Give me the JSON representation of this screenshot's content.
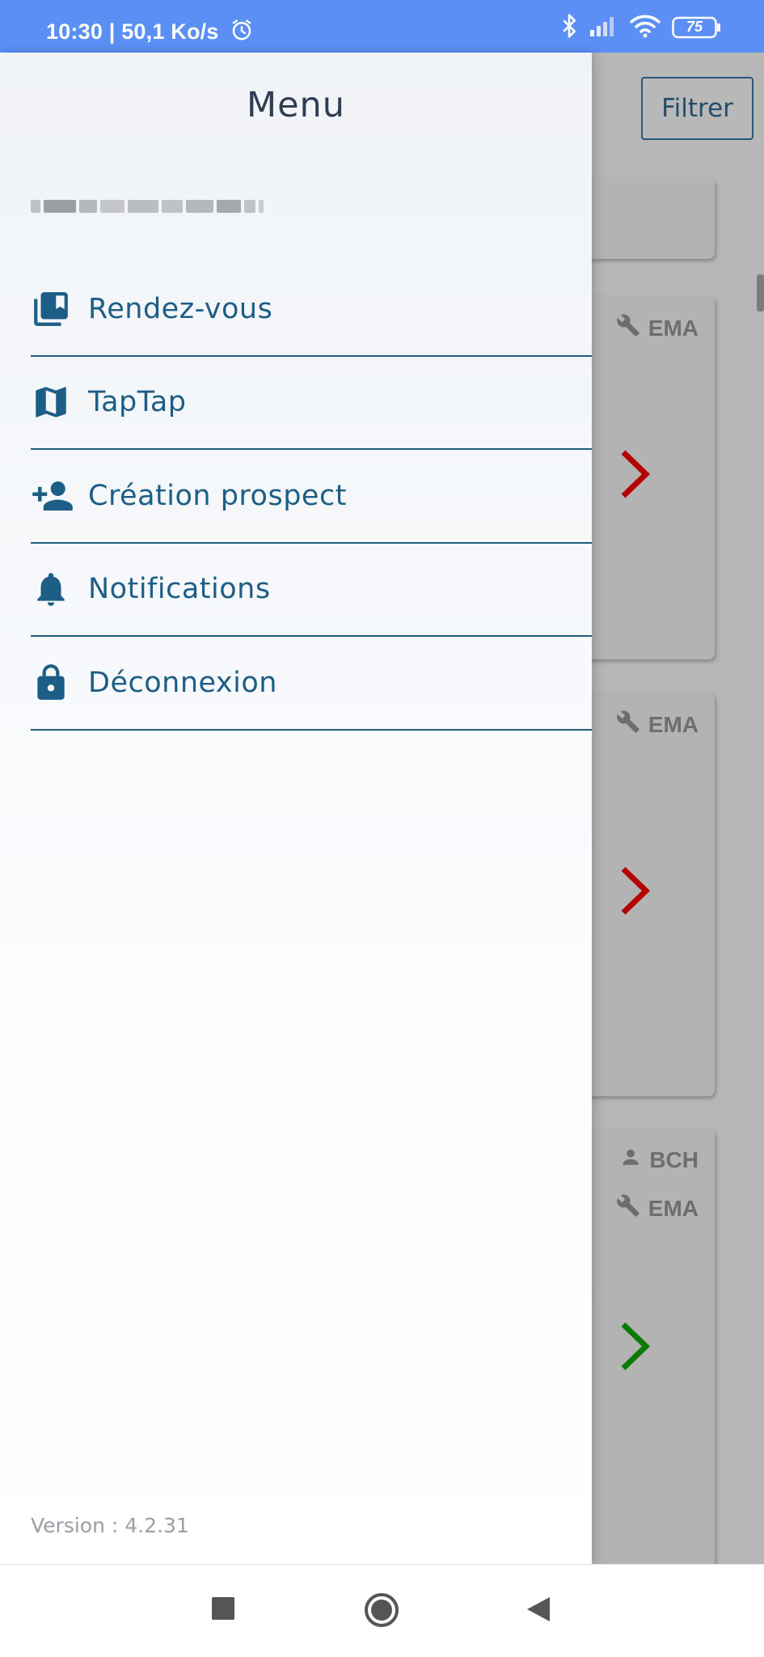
{
  "status_bar": {
    "time_speed": "10:30 | 50,1 Ko/s",
    "battery": "75",
    "icons": [
      "alarm-icon",
      "bluetooth-icon",
      "signal-icon",
      "wifi-icon",
      "battery-icon"
    ]
  },
  "background": {
    "filter_label": "Filtrer",
    "cards": [
      {
        "tags": [
          {
            "icon": "wrench-icon",
            "text": "EMA"
          }
        ],
        "arrow_color": "#b40000"
      },
      {
        "tags": [
          {
            "icon": "wrench-icon",
            "text": "EMA"
          }
        ],
        "arrow_color": "#b40000"
      },
      {
        "tags": [
          {
            "icon": "person-icon",
            "text": "BCH"
          },
          {
            "icon": "wrench-icon",
            "text": "EMA"
          }
        ],
        "arrow_color": "#0a7a00"
      }
    ]
  },
  "drawer": {
    "title": "Menu",
    "items": [
      {
        "label": "Rendez-vous",
        "icon": "library-books-icon"
      },
      {
        "label": "TapTap",
        "icon": "map-icon"
      },
      {
        "label": "Création prospect",
        "icon": "person-add-icon"
      },
      {
        "label": "Notifications",
        "icon": "bell-icon"
      },
      {
        "label": "Déconnexion",
        "icon": "lock-icon"
      }
    ],
    "version": "Version : 4.2.31"
  },
  "colors": {
    "status_bar": "#5b8ff5",
    "accent": "#1c5e86",
    "divider": "#1f5d80"
  }
}
